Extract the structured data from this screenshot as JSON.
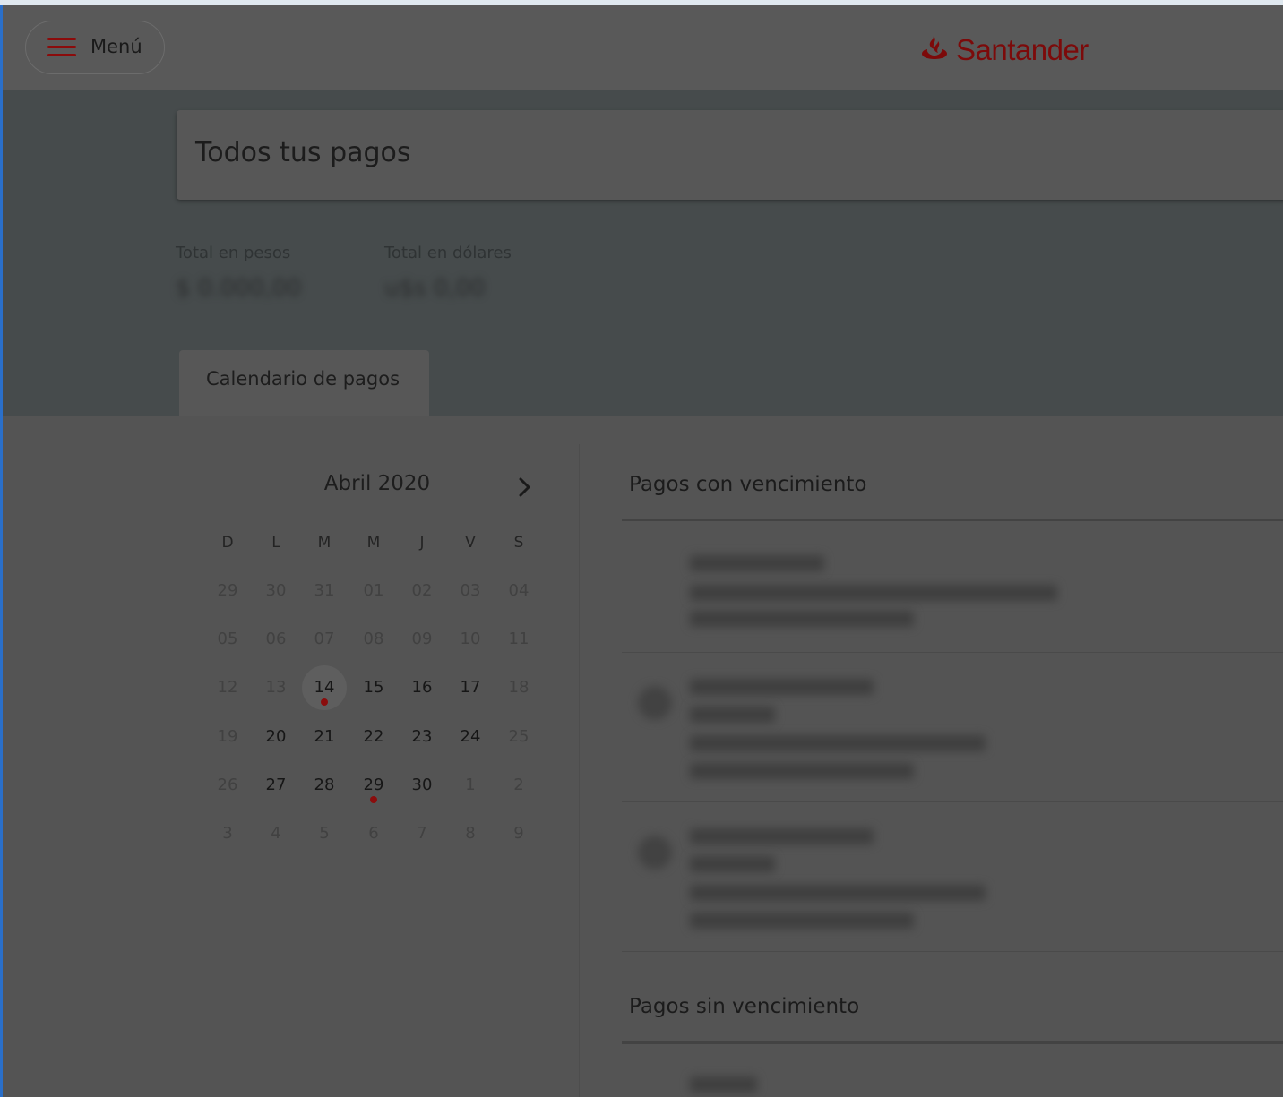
{
  "header": {
    "menu_label": "Menú",
    "logo_text": "Santander",
    "brand_color": "#7c0a0a"
  },
  "page": {
    "title": "Todos tus pagos",
    "totals": [
      {
        "label": "Total en pesos",
        "value": "$ 0.000,00"
      },
      {
        "label": "Total en dólares",
        "value": "u$s 0,00"
      }
    ],
    "tab_label": "Calendario de pagos"
  },
  "calendar": {
    "month_label": "Abril 2020",
    "weekdays": [
      "D",
      "L",
      "M",
      "M",
      "J",
      "V",
      "S"
    ],
    "weeks": [
      [
        "29",
        "30",
        "31",
        "01",
        "02",
        "03",
        "04"
      ],
      [
        "05",
        "06",
        "07",
        "08",
        "09",
        "10",
        "11"
      ],
      [
        "12",
        "13",
        "14",
        "15",
        "16",
        "17",
        "18"
      ],
      [
        "19",
        "20",
        "21",
        "22",
        "23",
        "24",
        "25"
      ],
      [
        "26",
        "27",
        "28",
        "29",
        "30",
        "1",
        "2"
      ],
      [
        "3",
        "4",
        "5",
        "6",
        "7",
        "8",
        "9"
      ]
    ],
    "today": "14",
    "days_with_payments": [
      "14",
      "29"
    ]
  },
  "sections": {
    "with_due": "Pagos con vencimiento",
    "without_due": "Pagos sin vencimiento"
  }
}
